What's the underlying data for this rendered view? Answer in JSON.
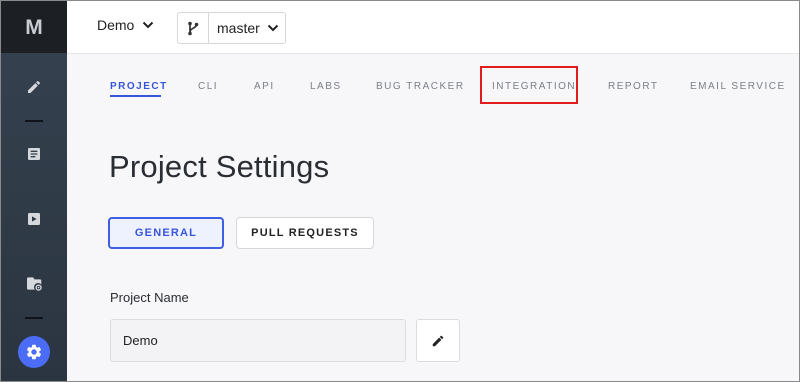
{
  "header": {
    "project": "Demo",
    "branch": "master"
  },
  "tabs": [
    {
      "label": "PROJECT",
      "active": true
    },
    {
      "label": "CLI",
      "active": false
    },
    {
      "label": "API",
      "active": false
    },
    {
      "label": "LABS",
      "active": false
    },
    {
      "label": "BUG TRACKER",
      "active": false
    },
    {
      "label": "INTEGRATION",
      "active": false
    },
    {
      "label": "REPORT",
      "active": false
    },
    {
      "label": "EMAIL SERVICE",
      "active": false
    }
  ],
  "page": {
    "title": "Project Settings",
    "subtabs": {
      "general": "GENERAL",
      "pull_requests": "PULL REQUESTS"
    },
    "active_subtab": "general",
    "project_name_label": "Project Name",
    "project_name_value": "Demo"
  },
  "sidebar": {
    "logo_letter": "M",
    "icons": [
      "edit-icon",
      "document-icon",
      "play-icon",
      "folder-settings-icon",
      "gear-icon"
    ]
  },
  "colors": {
    "accent": "#3755d8",
    "sidebar": "#2f3a47",
    "highlight": "#e01c1c"
  }
}
